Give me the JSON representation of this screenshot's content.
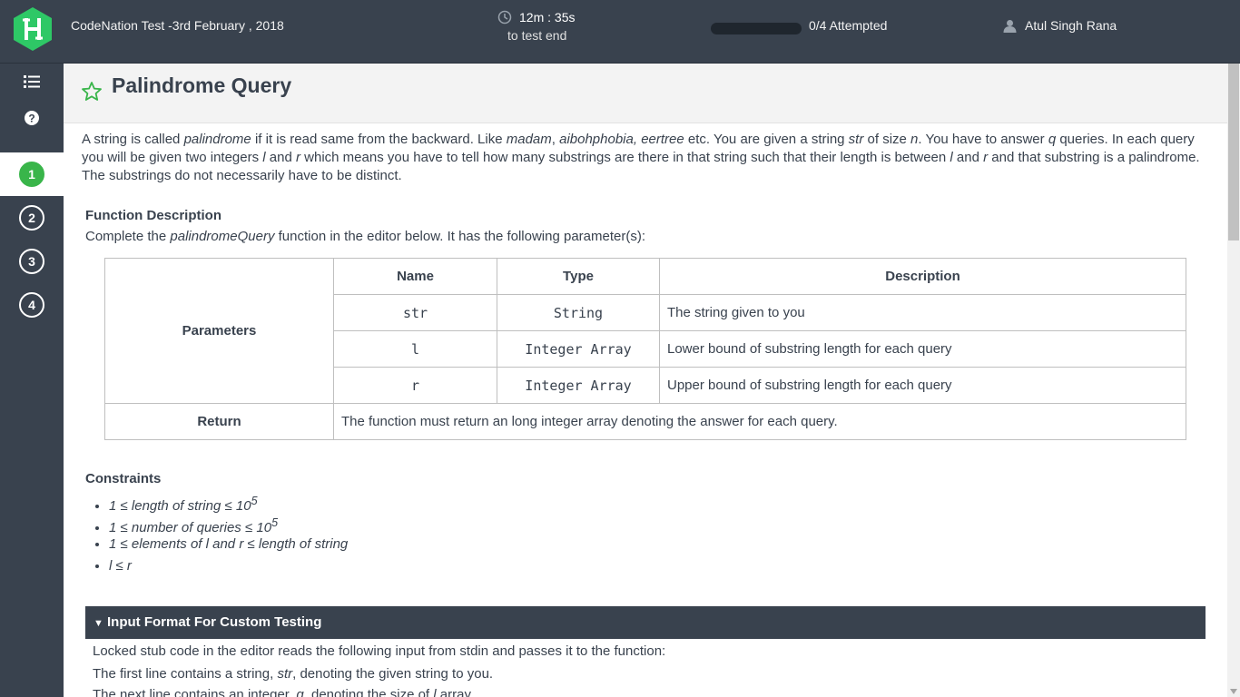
{
  "header": {
    "test_title": "CodeNation Test -3rd February , 2018",
    "timer_value": "12m : 35s",
    "timer_sub": "to test end",
    "progress_fraction": 0,
    "attempted": "0/4 Attempted",
    "user_name": "Atul Singh Rana"
  },
  "sidebar": {
    "icons": [
      "list-icon",
      "help-icon"
    ],
    "questions": [
      {
        "label": "1",
        "active": true
      },
      {
        "label": "2",
        "active": false
      },
      {
        "label": "3",
        "active": false
      },
      {
        "label": "4",
        "active": false
      }
    ]
  },
  "problem": {
    "title": "Palindrome Query",
    "intro": {
      "p1": "A string is called ",
      "i1": "palindrome",
      "p2": " if it is read same from the backward. Like ",
      "i2": "madam",
      "p3": ", ",
      "i3": "aibohphobia, eertree",
      "p4": " etc. You are given a string ",
      "i4": "str",
      "p5": " of size ",
      "i5": "n",
      "p6": ". You have to answer ",
      "i6": "q",
      "p7": " queries. In each query you will be given two integers ",
      "i7": "l",
      "p8": " and ",
      "i8": "r",
      "p9": " which means you have to tell how many substrings are there in that string such that their length is between ",
      "i9": "l",
      "p10": " and ",
      "i10": "r",
      "p11": " and that substring is a palindrome. The substrings do not necessarily have to be distinct."
    },
    "function_description": {
      "heading": "Function Description",
      "text_before": "Complete the ",
      "fn_name": "palindromeQuery",
      "text_after": " function in the editor below. It has the following parameter(s):"
    },
    "table": {
      "headers": [
        "Name",
        "Type",
        "Description"
      ],
      "parameters_label": "Parameters",
      "rows": [
        {
          "name": "str",
          "type": "String",
          "description": "The string given to you"
        },
        {
          "name": "l",
          "type": "Integer Array",
          "description": "Lower bound of substring length for each query"
        },
        {
          "name": "r",
          "type": "Integer Array",
          "description": "Upper bound of substring length for each query"
        }
      ],
      "return_label": "Return",
      "return_text": "The function must return an long integer array denoting the answer for each query."
    },
    "constraints": {
      "heading": "Constraints",
      "items": [
        {
          "text": "1 ≤ length of string ≤ 10",
          "sup": "5"
        },
        {
          "text": "1 ≤ number of queries ≤ 10",
          "sup": "5"
        },
        {
          "text": "1 ≤ elements of l and r ≤ length of string",
          "sup": ""
        },
        {
          "text": "l ≤ r",
          "sup": ""
        }
      ]
    },
    "input_format": {
      "heading": "Input Format For Custom Testing",
      "line1": "Locked stub code in the editor reads the following input from stdin and passes it to the function:",
      "line2_before": "The first line contains a string, ",
      "line2_var": "str",
      "line2_after": ", denoting the given string to you.",
      "line3_before": "The next line contains an integer, ",
      "line3_var": "q",
      "line3_mid": ", denoting the size of ",
      "line3_var2": "l",
      "line3_after": " array."
    }
  },
  "colors": {
    "topbar": "#39424e",
    "accent_green": "#39b54a",
    "text": "#39424e"
  }
}
